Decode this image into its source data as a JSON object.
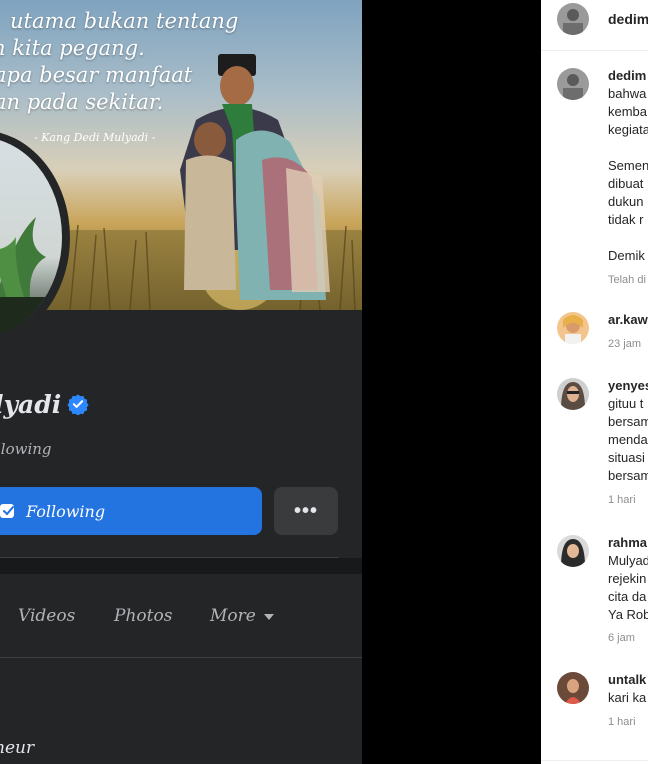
{
  "facebook": {
    "cover_quote": {
      "lines": [
        "utama bukan tentang",
        "n kita pegang.",
        "apa besar manfaat",
        "an pada sekitar."
      ],
      "author": "- Kang Dedi Mulyadi -"
    },
    "profile_name": "lyadi",
    "following_count": "llowing",
    "follow_button": "Following",
    "more_button": "•••",
    "tabs": [
      "Videos",
      "Photos",
      "More"
    ],
    "intro_text": "neur"
  },
  "instagram": {
    "header_username": "dedimu",
    "comments": [
      {
        "username": "dedim",
        "lines": [
          "bahwa",
          "kemba",
          "kegiata",
          "",
          "Semen",
          "dibuat",
          "dukun",
          "tidak r",
          "",
          "Demik"
        ],
        "time": "Telah di"
      },
      {
        "username": "ar.kaw",
        "lines": [],
        "time": "23 jam"
      },
      {
        "username": "yenyes",
        "lines": [
          "gituu t",
          "bersam",
          "menda",
          "situasi",
          "bersam"
        ],
        "time": "1 hari"
      },
      {
        "username": "rahma",
        "lines": [
          "Mulyad",
          "rejekin",
          "cita da",
          "Ya Rob"
        ],
        "time": "6 jam"
      },
      {
        "username": "untalk",
        "lines": [
          "kari ka"
        ],
        "time": "1 hari"
      }
    ]
  }
}
